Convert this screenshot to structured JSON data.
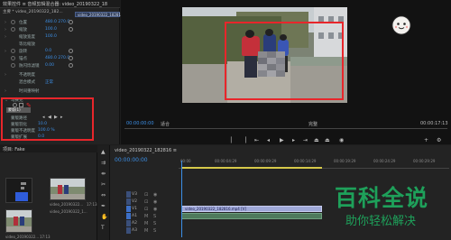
{
  "effects": {
    "header": "效果控件 ≡ 音频剪辑混合器: video_20190322_18",
    "source_line": "主要 * video_20190322_182...",
    "clip_name": "video_20190322_182816",
    "props": [
      {
        "name": "位置",
        "value": "480.0  270.0"
      },
      {
        "name": "缩放",
        "value": "100.0"
      },
      {
        "name": "缩放宽度",
        "value": "100.0"
      },
      {
        "name": "等比缩放",
        "value": ""
      },
      {
        "name": "旋转",
        "value": "0.0"
      },
      {
        "name": "锚点",
        "value": "480.0  270.0"
      },
      {
        "name": "防闪烁滤镜",
        "value": "0.00"
      },
      {
        "name": "不透明度",
        "value": ""
      },
      {
        "name": "混合模式",
        "value": "正常"
      },
      {
        "name": "时间重映射",
        "value": ""
      }
    ],
    "mosaic_label": "马赛克",
    "mask_label": "蒙版(1)",
    "mask_rows": [
      {
        "name": "蒙版路径",
        "value": ""
      },
      {
        "name": "蒙版羽化",
        "value": "10.0"
      },
      {
        "name": "蒙版不透明度",
        "value": "100.0 %"
      },
      {
        "name": "蒙版扩展",
        "value": "0.0"
      }
    ]
  },
  "program": {
    "timecode": "00:00:00:00",
    "fit": "适合",
    "full": "完整",
    "duration": "00:00:17:13"
  },
  "project": {
    "header": "项目: Fake",
    "thumb_labels": [
      "video_20190322...",
      "video_20190322_1...",
      "video_20190322..."
    ],
    "thumb_durations": [
      "17:13",
      "17:13"
    ]
  },
  "timeline": {
    "tab": "video_20190322_182816 ≡",
    "timecode": "00:00:00:00",
    "ruler": [
      "00:00",
      "00:00:04:29",
      "00:00:09:29",
      "00:00:14:29",
      "00:00:19:29",
      "00:00:24:29",
      "00:00:29:29"
    ],
    "tracks": [
      "V3",
      "V2",
      "V1",
      "A1",
      "A2",
      "A3"
    ],
    "clip_v1": "video_20190322_182816.mp4 [V]",
    "clip_a1": ""
  },
  "watermark": {
    "title": "百科全说",
    "subtitle": "助你轻松解决"
  },
  "colors": {
    "accent_blue": "#3c8fe6",
    "highlight_red": "#e8262b",
    "watermark_green": "#1ea05a"
  }
}
